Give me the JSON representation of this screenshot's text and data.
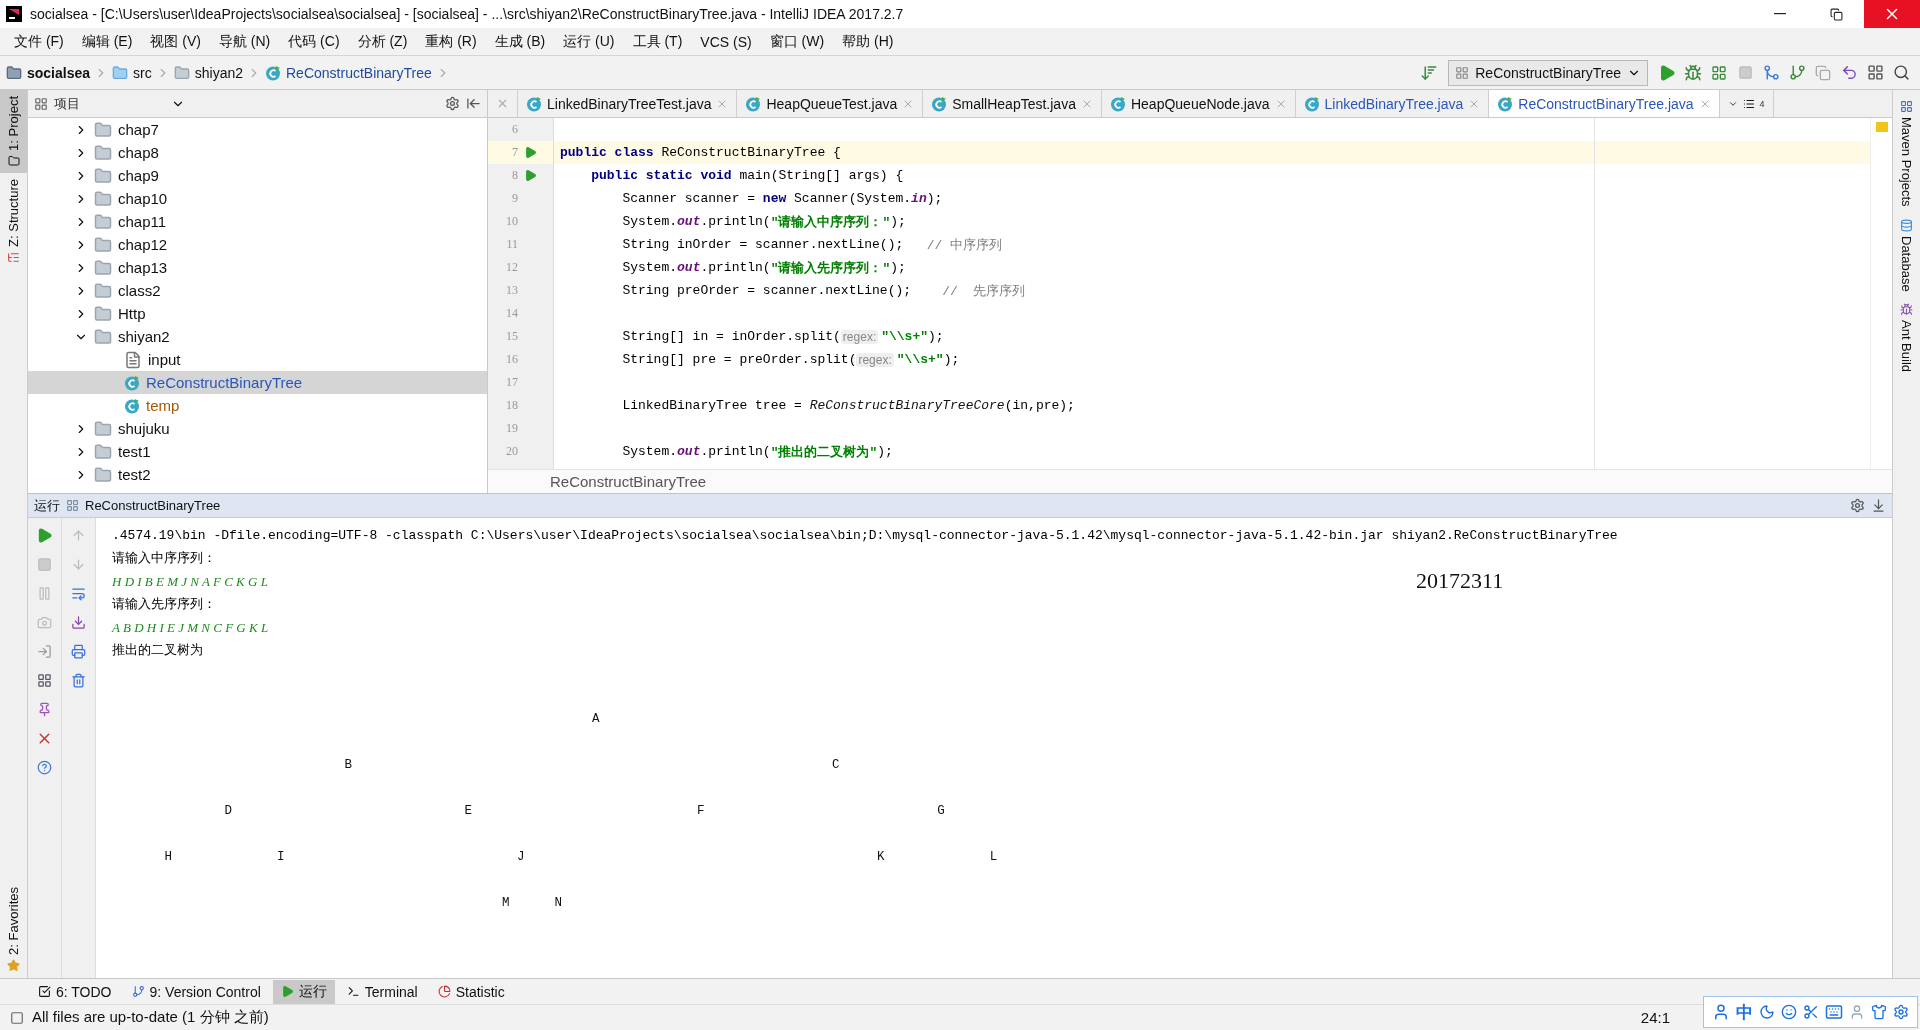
{
  "window": {
    "title": "socialsea - [C:\\Users\\user\\IdeaProjects\\socialsea\\socialsea] - [socialsea] - ...\\src\\shiyan2\\ReConstructBinaryTree.java - IntelliJ IDEA 2017.2.7"
  },
  "menu": [
    "文件 (F)",
    "编辑 (E)",
    "视图 (V)",
    "导航 (N)",
    "代码 (C)",
    "分析 (Z)",
    "重构 (R)",
    "生成 (B)",
    "运行 (U)",
    "工具 (T)",
    "VCS (S)",
    "窗口 (W)",
    "帮助 (H)"
  ],
  "breadcrumbs": [
    {
      "label": "socialsea",
      "kind": "project"
    },
    {
      "label": "src",
      "kind": "source"
    },
    {
      "label": "shiyan2",
      "kind": "folder"
    },
    {
      "label": "ReConstructBinaryTree",
      "kind": "class"
    }
  ],
  "run_config": "ReConstructBinaryTree",
  "left_tools": [
    {
      "label": "1: Project",
      "selected": true,
      "kind": "project"
    },
    {
      "label": "Z: Structure",
      "selected": false,
      "kind": "structure"
    },
    {
      "label": "2: Favorites",
      "selected": false,
      "kind": "favorites"
    }
  ],
  "right_tools": [
    {
      "label": "Maven Projects",
      "kind": "maven"
    },
    {
      "label": "Database",
      "kind": "database"
    },
    {
      "label": "Ant Build",
      "kind": "ant"
    }
  ],
  "project_panel": {
    "title": "项目",
    "tree": [
      {
        "label": "chap7",
        "kind": "folder",
        "expanded": false,
        "selected": false
      },
      {
        "label": "chap8",
        "kind": "folder",
        "expanded": false,
        "selected": false
      },
      {
        "label": "chap9",
        "kind": "folder",
        "expanded": false,
        "selected": false
      },
      {
        "label": "chap10",
        "kind": "folder",
        "expanded": false,
        "selected": false
      },
      {
        "label": "chap11",
        "kind": "folder",
        "expanded": false,
        "selected": false
      },
      {
        "label": "chap12",
        "kind": "folder",
        "expanded": false,
        "selected": false
      },
      {
        "label": "chap13",
        "kind": "folder",
        "expanded": false,
        "selected": false
      },
      {
        "label": "class2",
        "kind": "folder",
        "expanded": false,
        "selected": false
      },
      {
        "label": "Http",
        "kind": "folder",
        "expanded": false,
        "selected": false
      },
      {
        "label": "shiyan2",
        "kind": "folder",
        "expanded": true,
        "selected": false,
        "children": [
          {
            "label": "input",
            "kind": "file",
            "color": "#111111",
            "selected": false
          },
          {
            "label": "ReConstructBinaryTree",
            "kind": "class",
            "color": "#2a56b8",
            "selected": true
          },
          {
            "label": "temp",
            "kind": "class",
            "color": "#a35a00",
            "selected": false
          }
        ]
      },
      {
        "label": "shujuku",
        "kind": "folder",
        "expanded": false,
        "selected": false
      },
      {
        "label": "test1",
        "kind": "folder",
        "expanded": false,
        "selected": false
      },
      {
        "label": "test2",
        "kind": "folder",
        "expanded": false,
        "selected": false
      }
    ]
  },
  "editor_tabs": [
    {
      "label": "LinkedBinaryTreeTest.java",
      "selected": false,
      "modified": false
    },
    {
      "label": "HeapQueueTest.java",
      "selected": false,
      "modified": false
    },
    {
      "label": "SmallHeapTest.java",
      "selected": false,
      "modified": false
    },
    {
      "label": "HeapQueueNode.java",
      "selected": false,
      "modified": false
    },
    {
      "label": "LinkedBinaryTree.java",
      "selected": false,
      "modified": true
    },
    {
      "label": "ReConstructBinaryTree.java",
      "selected": true,
      "modified": true
    }
  ],
  "hidden_tab_count": "4",
  "code": [
    {
      "number": "6",
      "current": false
    },
    {
      "number": "7",
      "current": true,
      "run": true,
      "segments": [
        {
          "kind": "kw",
          "text": "public class"
        },
        {
          "kind": "plain",
          "text": " ReConstructBinaryTree {"
        }
      ]
    },
    {
      "number": "8",
      "current": false,
      "run": true,
      "segments": [
        {
          "kind": "kw",
          "text": "    public static void"
        },
        {
          "kind": "plain",
          "text": " main(String[] args) {"
        }
      ]
    },
    {
      "number": "9",
      "current": false,
      "segments": [
        {
          "kind": "plain",
          "text": "        Scanner scanner = "
        },
        {
          "kind": "kw",
          "text": "new"
        },
        {
          "kind": "plain",
          "text": " Scanner(System."
        },
        {
          "kind": "field",
          "text": "in"
        },
        {
          "kind": "plain",
          "text": ");"
        }
      ]
    },
    {
      "number": "10",
      "current": false,
      "segments": [
        {
          "kind": "plain",
          "text": "        System."
        },
        {
          "kind": "field",
          "text": "out"
        },
        {
          "kind": "plain",
          "text": ".println("
        },
        {
          "kind": "str",
          "text": "\"请输入中序序列：\""
        },
        {
          "kind": "plain",
          "text": ");"
        }
      ]
    },
    {
      "number": "11",
      "current": false,
      "segments": [
        {
          "kind": "plain",
          "text": "        String inOrder = scanner.nextLine();   "
        },
        {
          "kind": "comment",
          "text": "// 中序序列"
        }
      ]
    },
    {
      "number": "12",
      "current": false,
      "segments": [
        {
          "kind": "plain",
          "text": "        System."
        },
        {
          "kind": "field",
          "text": "out"
        },
        {
          "kind": "plain",
          "text": ".println("
        },
        {
          "kind": "str",
          "text": "\"请输入先序序列：\""
        },
        {
          "kind": "plain",
          "text": ");"
        }
      ]
    },
    {
      "number": "13",
      "current": false,
      "segments": [
        {
          "kind": "plain",
          "text": "        String preOrder = scanner.nextLine();    "
        },
        {
          "kind": "comment",
          "text": "//  先序序列"
        }
      ]
    },
    {
      "number": "14",
      "current": false
    },
    {
      "number": "15",
      "current": false,
      "segments": [
        {
          "kind": "plain",
          "text": "        String[] in = inOrder.split("
        },
        {
          "kind": "hint",
          "text": "regex:"
        },
        {
          "kind": "str",
          "text": "\"\\\\s+\""
        },
        {
          "kind": "plain",
          "text": ");"
        }
      ]
    },
    {
      "number": "16",
      "current": false,
      "segments": [
        {
          "kind": "plain",
          "text": "        String[] pre = preOrder.split("
        },
        {
          "kind": "hint",
          "text": "regex:"
        },
        {
          "kind": "str",
          "text": "\"\\\\s+\""
        },
        {
          "kind": "plain",
          "text": ");"
        }
      ]
    },
    {
      "number": "17",
      "current": false
    },
    {
      "number": "18",
      "current": false,
      "segments": [
        {
          "kind": "plain",
          "text": "        LinkedBinaryTree tree = "
        },
        {
          "kind": "call",
          "text": "ReConstructBinaryTreeCore"
        },
        {
          "kind": "plain",
          "text": "(in,pre);"
        }
      ]
    },
    {
      "number": "19",
      "current": false
    },
    {
      "number": "20",
      "current": false,
      "segments": [
        {
          "kind": "plain",
          "text": "        System."
        },
        {
          "kind": "field",
          "text": "out"
        },
        {
          "kind": "plain",
          "text": ".println("
        },
        {
          "kind": "str",
          "text": "\"推出的二叉树为\""
        },
        {
          "kind": "plain",
          "text": ");"
        }
      ]
    }
  ],
  "editor_breadcrumb": "ReConstructBinaryTree",
  "run_panel": {
    "title": "运行",
    "config": "ReConstructBinaryTree",
    "console": [
      {
        "kind": "output",
        "text": ".4574.19\\bin -Dfile.encoding=UTF-8 -classpath C:\\Users\\user\\IdeaProjects\\socialsea\\socialsea\\bin;D:\\mysql-connector-java-5.1.42\\mysql-connector-java-5.1.42-bin.jar shiyan2.ReConstructBinaryTree"
      },
      {
        "kind": "output",
        "text": "请输入中序序列："
      },
      {
        "kind": "input",
        "text": "H D I B E M J N A F C K G L"
      },
      {
        "kind": "output",
        "text": "请输入先序序列："
      },
      {
        "kind": "input",
        "text": "A B D H I E J M N C F G K L"
      },
      {
        "kind": "output",
        "text": "推出的二叉树为"
      }
    ],
    "tree_rows": [
      "                                                                A",
      "                               B                                                                C",
      "               D                               E                              F                               G",
      "       H              I                               J                                               K              L",
      "                                                    M      N"
    ],
    "note": "20172311"
  },
  "bottom_tabs": [
    {
      "label": "6: TODO",
      "kind": "todo",
      "selected": false
    },
    {
      "label": "9: Version Control",
      "kind": "vcs",
      "selected": false
    },
    {
      "label": "运行",
      "kind": "run",
      "selected": true
    },
    {
      "label": "Terminal",
      "kind": "terminal",
      "selected": false
    },
    {
      "label": "Statistic",
      "kind": "statistic",
      "selected": false
    }
  ],
  "status_bar": {
    "message": "All files are up-to-date (1 分钟 之前)",
    "position": "24:1"
  },
  "ime": {
    "label": "中"
  }
}
